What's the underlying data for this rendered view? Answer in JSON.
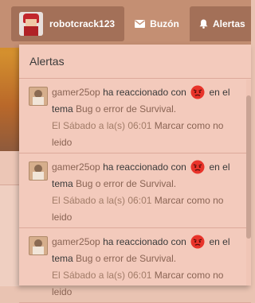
{
  "nav": {
    "username": "robotcrack123",
    "inbox_label": "Buzón",
    "alerts_label": "Alertas"
  },
  "alerts_panel": {
    "title": "Alertas",
    "items": [
      {
        "user": "gamer25op",
        "action": "ha reaccionado con",
        "connector": "en el tema",
        "thread": "Bug o error de Survival.",
        "time": "El Sábado a la(s) 06:01",
        "mark_read": "Marcar como no leido"
      },
      {
        "user": "gamer25op",
        "action": "ha reaccionado con",
        "connector": "en el tema",
        "thread": "Bug o error de Survival.",
        "time": "El Sábado a la(s) 06:01",
        "mark_read": "Marcar como no leido"
      },
      {
        "user": "gamer25op",
        "action": "ha reaccionado con",
        "connector": "en el tema",
        "thread": "Bug o error de Survival.",
        "time": "El Sábado a la(s) 06:01",
        "mark_read": "Marcar como no leido"
      }
    ],
    "reaction_icon": "angry-face-icon"
  },
  "colors": {
    "navbar": "#c48f73",
    "panel": "#f3cabc",
    "link": "#8a6454"
  }
}
